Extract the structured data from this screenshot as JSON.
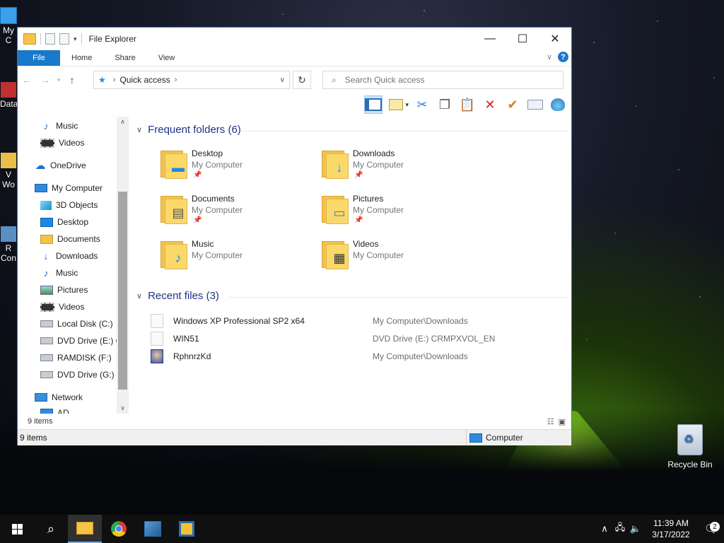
{
  "window": {
    "title": "File Explorer",
    "controls": {
      "minimize": "—",
      "maximize": "☐",
      "close": "✕"
    }
  },
  "ribbon": {
    "tabs": [
      "File",
      "Home",
      "Share",
      "View"
    ]
  },
  "address": {
    "breadcrumb": "Quick access",
    "search_placeholder": "Search Quick access"
  },
  "sidebar": {
    "items": [
      {
        "label": "Music",
        "icon": "music-note-icon"
      },
      {
        "label": "Videos",
        "icon": "video-icon"
      },
      {
        "label": "OneDrive",
        "icon": "cloud-icon"
      },
      {
        "label": "My Computer",
        "icon": "computer-icon"
      },
      {
        "label": "3D Objects",
        "icon": "3d-objects-icon"
      },
      {
        "label": "Desktop",
        "icon": "desktop-icon"
      },
      {
        "label": "Documents",
        "icon": "documents-icon"
      },
      {
        "label": "Downloads",
        "icon": "download-icon"
      },
      {
        "label": "Music",
        "icon": "music-note-icon"
      },
      {
        "label": "Pictures",
        "icon": "pictures-icon"
      },
      {
        "label": "Videos",
        "icon": "video-icon"
      },
      {
        "label": "Local Disk (C:)",
        "icon": "drive-icon"
      },
      {
        "label": "DVD Drive (E:) CI",
        "icon": "dvd-drive-icon"
      },
      {
        "label": "RAMDISK (F:)",
        "icon": "drive-icon"
      },
      {
        "label": "DVD Drive (G:) C",
        "icon": "dvd-drive-icon"
      },
      {
        "label": "Network",
        "icon": "network-icon"
      },
      {
        "label": "AD",
        "icon": "computer-icon"
      }
    ]
  },
  "frequent": {
    "header": "Frequent folders (6)",
    "items": [
      {
        "name": "Desktop",
        "location": "My Computer",
        "icon": "desktop-icon"
      },
      {
        "name": "Downloads",
        "location": "My Computer",
        "icon": "download-icon"
      },
      {
        "name": "Documents",
        "location": "My Computer",
        "icon": "documents-icon"
      },
      {
        "name": "Pictures",
        "location": "My Computer",
        "icon": "pictures-icon"
      },
      {
        "name": "Music",
        "location": "My Computer",
        "icon": "music-note-icon"
      },
      {
        "name": "Videos",
        "location": "My Computer",
        "icon": "video-icon"
      }
    ]
  },
  "recent": {
    "header": "Recent files (3)",
    "items": [
      {
        "name": "Windows XP Professional SP2 x64",
        "path": "My Computer\\Downloads"
      },
      {
        "name": "WIN51",
        "path": "DVD Drive (E:) CRMPXVOL_EN"
      },
      {
        "name": "RphnrzKd",
        "path": "My Computer\\Downloads"
      }
    ]
  },
  "status": {
    "inner_count": "9 items",
    "outer_count": "9 items",
    "location": "Computer"
  },
  "desktop": {
    "left_labels": [
      "My C",
      "Data",
      "V",
      "Wo",
      "R",
      "Con"
    ],
    "recycle_bin": "Recycle Bin"
  },
  "taskbar": {
    "time": "11:39 AM",
    "date": "3/17/2022",
    "notifications": "2"
  }
}
